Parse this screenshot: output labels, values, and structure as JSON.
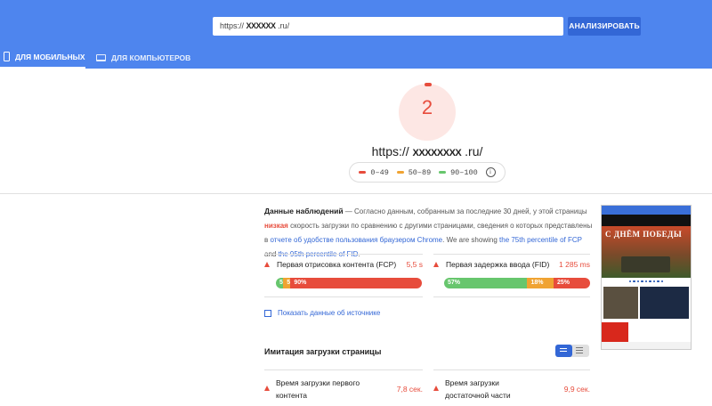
{
  "search": {
    "url": "https:// ",
    "url_masked": "XXXXXX",
    "url_suffix": ".ru/",
    "button": "АНАЛИЗИРОВАТЬ"
  },
  "tabs": [
    {
      "label": "ДЛЯ МОБИЛЬНЫХ",
      "icon": "phone-icon",
      "active": true
    },
    {
      "label": "ДЛЯ КОМПЬЮТЕРОВ",
      "icon": "laptop-icon",
      "active": false
    }
  ],
  "score": {
    "value": "2",
    "color": "#e74c3c"
  },
  "site": {
    "prefix": "https://",
    "masked": "XXXXXXXX",
    "suffix": ".ru/"
  },
  "legend": [
    {
      "label": "0–49",
      "color": "#e74c3c"
    },
    {
      "label": "50–89",
      "color": "#f0a332"
    },
    {
      "label": "90–100",
      "color": "#67c66d"
    }
  ],
  "field_data": {
    "title": "Данные наблюдений",
    "text_1": " — Согласно данным, собранным за последние 30 дней, у этой страницы ",
    "low_word": "низкая",
    "text_2": " скорость загрузки по сравнению с другими страницами, сведения о которых представлены в ",
    "report_link": "отчете об удобстве пользования браузером Chrome",
    "text_3": ". We are showing ",
    "fcp_link": "the 75th percentile of FCP",
    "text_4": " and ",
    "fid_link": "the 95th percentile of FID",
    "text_5": "."
  },
  "metrics": {
    "fcp": {
      "label": "Первая отрисовка контента (FCP)",
      "value": "5,5 s",
      "segments": [
        {
          "label": "5%",
          "pct": 5
        },
        {
          "label": "5%",
          "pct": 5
        },
        {
          "label": "90%",
          "pct": 90
        }
      ]
    },
    "fid": {
      "label": "Первая задержка ввода (FID)",
      "value": "1 285 ms",
      "segments": [
        {
          "label": "57%",
          "pct": 57
        },
        {
          "label": "18%",
          "pct": 18
        },
        {
          "label": "25%",
          "pct": 25
        }
      ]
    }
  },
  "origin_checkbox": "Показать данные об источнике",
  "lab": {
    "title": "Имитация загрузки страницы",
    "items": [
      {
        "label": "Время загрузки первого контента",
        "value": "7,8 сек."
      },
      {
        "label": "Время загрузки достаточной части контента",
        "value": "9,9 сек."
      }
    ]
  },
  "thumbnail": {
    "hero_text": "С ДНЁМ ПОБЕДЫ"
  }
}
